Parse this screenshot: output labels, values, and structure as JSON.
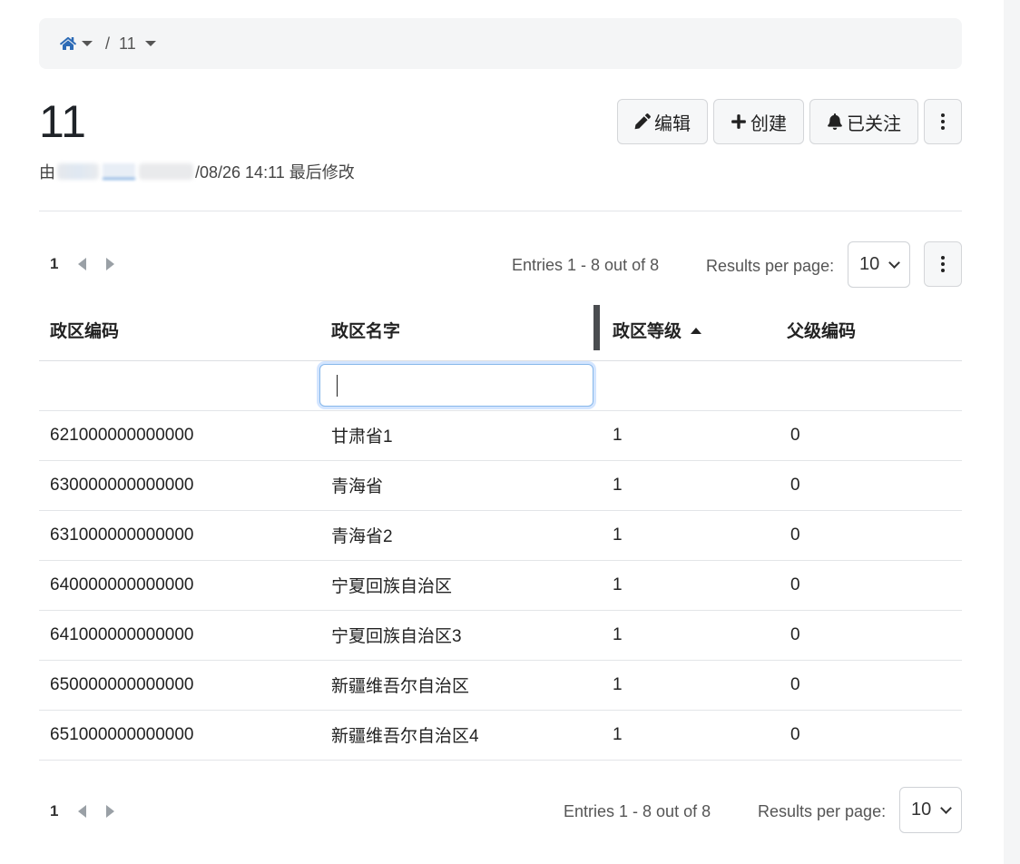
{
  "breadcrumb": {
    "current": "11"
  },
  "page": {
    "title": "11",
    "modified_prefix": "由",
    "modified_text": "/08/26 14:11 最后修改"
  },
  "actions": {
    "edit_label": "编辑",
    "create_label": "创建",
    "following_label": "已关注"
  },
  "pager_top": {
    "page": "1",
    "entries": "Entries 1 - 8 out of 8",
    "results_label": "Results per page:",
    "results_value": "10"
  },
  "table": {
    "headers": [
      "政区编码",
      "政区名字",
      "政区等级",
      "父级编码"
    ],
    "sorted_column": "政区等级",
    "sort_direction": "ascending",
    "rows": [
      [
        "621000000000000",
        "甘肃省1",
        "1",
        "0"
      ],
      [
        "630000000000000",
        "青海省",
        "1",
        "0"
      ],
      [
        "631000000000000",
        "青海省2",
        "1",
        "0"
      ],
      [
        "640000000000000",
        "宁夏回族自治区",
        "1",
        "0"
      ],
      [
        "641000000000000",
        "宁夏回族自治区3",
        "1",
        "0"
      ],
      [
        "650000000000000",
        "新疆维吾尔自治区",
        "1",
        "0"
      ],
      [
        "651000000000000",
        "新疆维吾尔自治区4",
        "1",
        "0"
      ]
    ]
  },
  "pager_bottom": {
    "page": "1",
    "entries": "Entries 1 - 8 out of 8",
    "results_label": "Results per page:",
    "results_value": "10"
  },
  "colors": {
    "accent": "#2d6bb6",
    "focus": "#86b7ea"
  }
}
